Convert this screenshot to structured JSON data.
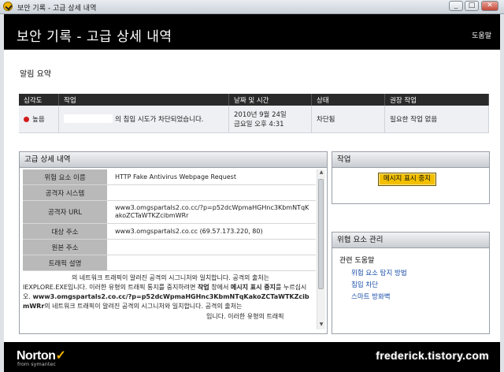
{
  "window": {
    "title": "보안 기록 - 고급 상세 내역",
    "buttons": [
      "_",
      "□",
      "✕"
    ]
  },
  "header": {
    "title": "보안 기록 - 고급 상세 내역",
    "help": "도움말"
  },
  "summary": {
    "title": "알림 요약",
    "columns": [
      "심각도",
      "작업",
      "날짜 및 시간",
      "상태",
      "권장 작업"
    ],
    "row": {
      "severity": "높음",
      "action": "의 침입 시도가 차단되었습니다.",
      "date_line1": "2010년 9월 24일",
      "date_line2": "금요일 오후 4:31",
      "status": "차단됨",
      "recommended": "필요한 작업 없음"
    }
  },
  "details": {
    "title": "고급 상세 내역",
    "rows": [
      {
        "label": "위험 요소 이름",
        "value": "HTTP Fake Antivirus Webpage Request"
      },
      {
        "label": "공격자 시스템",
        "value": ""
      },
      {
        "label": "공격자 URL",
        "value": "www3.omgspartals2.co.cc/?p=p52dcWpmaHGHnc3KbmNTqKakoZCTaWTKZcibmWRr"
      },
      {
        "label": "대상 주소",
        "value": "www3.omgspartals2.co.cc (69.57.173.220, 80)"
      },
      {
        "label": "원본 주소",
        "value": ""
      },
      {
        "label": "트래픽 설명",
        "value": ""
      }
    ],
    "description": {
      "p1": "의 네트워크 트래픽이 알려진 공격의 시그니처와 일치합니다. 공격의 출처는",
      "p2": "IEXPLORE.EXE입니다. 이러한 유형의 트래픽 통지를 중지하려면",
      "p2_bold": "작업",
      "p2b": "창에서",
      "p2_bold2": "메시지 표시 중지",
      "p2c": "를 누르십시오.",
      "p3_bold": "www3.omgspartals2.co.cc/?p=p52dcWpmaHGHnc3KbmNTqKakoZCTaWTKZcibmWRr",
      "p3": "의 네트워크 트래픽이 알려진 공격의 시그니처와 일치합니다. 공격의 출처는",
      "p4": "입니다. 이러한 유형의 트래픽"
    }
  },
  "action": {
    "title": "작업",
    "button": "메시지 표시 중지"
  },
  "threat": {
    "title": "위협 요소 관리",
    "subtitle": "관련 도움말",
    "links": [
      "위험 요소 탐지 방법",
      "침입 차단",
      "스마트 방화벽"
    ]
  },
  "footer": {
    "logo": "Norton",
    "logo_sub": "from symantec",
    "watermark": "frederick.tistory.com"
  },
  "colors": {
    "accent": "#f2b400",
    "severity_high": "#d21b1b",
    "link": "#1a4ea8"
  }
}
